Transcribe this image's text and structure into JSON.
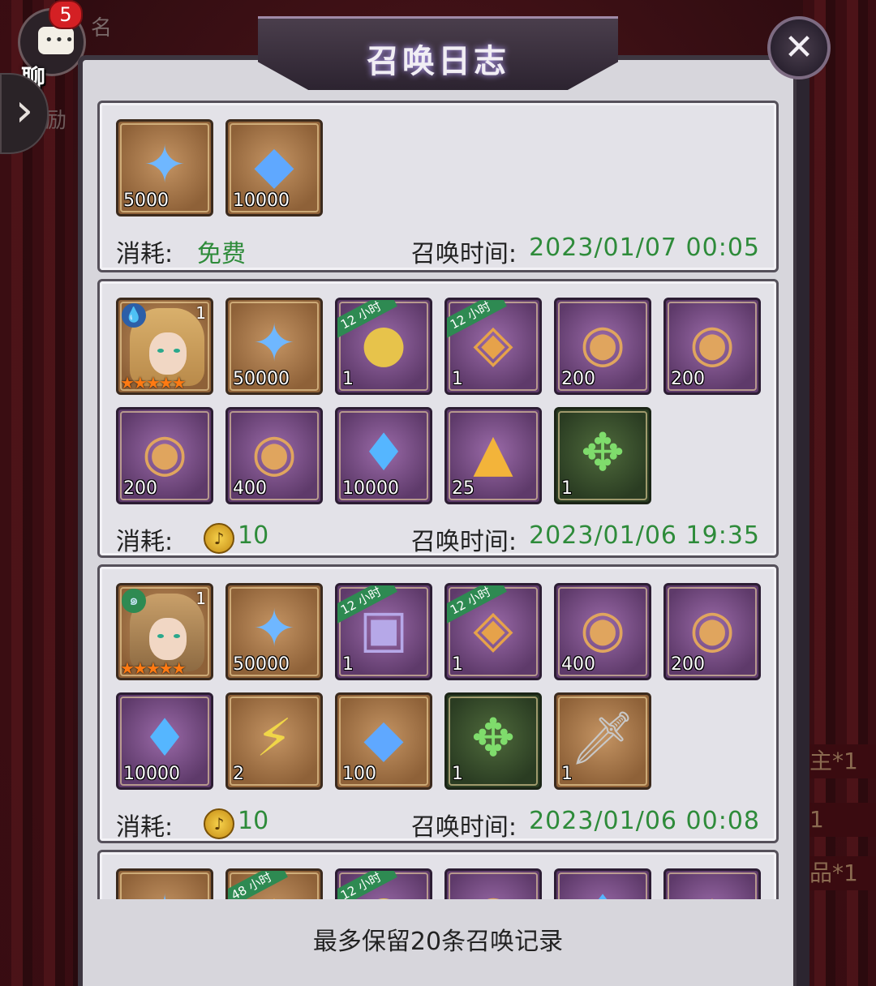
{
  "title": "召唤日志",
  "chat": {
    "badge": "5",
    "label": "聊 天"
  },
  "background": {
    "name_fragment": "名",
    "reward_fragment": "励"
  },
  "background_right": [
    "主*1",
    "1",
    "品*1"
  ],
  "records": [
    {
      "items": [
        {
          "kind": "exp",
          "count": "5000",
          "frame": "brown",
          "icon": "exp-icon"
        },
        {
          "kind": "diamond",
          "count": "10000",
          "frame": "brown",
          "icon": "diamond-icon"
        }
      ],
      "cost_label": "消耗:",
      "cost_text": "免费",
      "time_label": "召唤时间:",
      "time": "2023/01/07 00:05"
    },
    {
      "items": [
        {
          "kind": "hero",
          "count": "1",
          "frame": "brown",
          "icon": "hero-portrait-icon",
          "element": "water"
        },
        {
          "kind": "exp",
          "count": "50000",
          "frame": "brown",
          "icon": "exp-icon"
        },
        {
          "kind": "gold",
          "count": "1",
          "frame": "purple",
          "icon": "gold-coins-icon",
          "tag": "12 小时"
        },
        {
          "kind": "ore",
          "count": "1",
          "frame": "purple",
          "icon": "ore-icon",
          "tag": "12 小时"
        },
        {
          "kind": "orb",
          "count": "200",
          "frame": "purple",
          "icon": "orb-icon"
        },
        {
          "kind": "orb",
          "count": "200",
          "frame": "purple",
          "icon": "orb-icon"
        },
        {
          "kind": "orb",
          "count": "200",
          "frame": "purple",
          "icon": "orb-icon"
        },
        {
          "kind": "orb",
          "count": "400",
          "frame": "purple",
          "icon": "orb-icon"
        },
        {
          "kind": "crystal",
          "count": "10000",
          "frame": "purple",
          "icon": "crystal-icon"
        },
        {
          "kind": "rune",
          "count": "25",
          "frame": "purple",
          "icon": "rune-icon"
        },
        {
          "kind": "emblem",
          "count": "1",
          "frame": "green",
          "icon": "emblem-icon"
        }
      ],
      "cost_label": "消耗:",
      "cost_value": "10",
      "time_label": "召唤时间:",
      "time": "2023/01/06 19:35"
    },
    {
      "items": [
        {
          "kind": "hero",
          "count": "1",
          "frame": "brown",
          "icon": "hero-portrait-icon",
          "element": "wind"
        },
        {
          "kind": "exp",
          "count": "50000",
          "frame": "brown",
          "icon": "exp-icon"
        },
        {
          "kind": "gift",
          "count": "1",
          "frame": "purple",
          "icon": "exp-gift-box-icon",
          "tag": "12 小时"
        },
        {
          "kind": "ore",
          "count": "1",
          "frame": "purple",
          "icon": "ore-icon",
          "tag": "12 小时"
        },
        {
          "kind": "orb",
          "count": "400",
          "frame": "purple",
          "icon": "orb-icon"
        },
        {
          "kind": "orb",
          "count": "200",
          "frame": "purple",
          "icon": "orb-icon"
        },
        {
          "kind": "crystal",
          "count": "10000",
          "frame": "purple",
          "icon": "crystal-icon"
        },
        {
          "kind": "lightning",
          "count": "2",
          "frame": "brown",
          "icon": "lightning-icon"
        },
        {
          "kind": "diamond",
          "count": "100",
          "frame": "brown",
          "icon": "diamond-icon"
        },
        {
          "kind": "emblem",
          "count": "1",
          "frame": "green",
          "icon": "emblem-icon"
        },
        {
          "kind": "sword",
          "count": "1",
          "frame": "brown",
          "icon": "sword-icon"
        }
      ],
      "cost_label": "消耗:",
      "cost_value": "10",
      "time_label": "召唤时间:",
      "time": "2023/01/06 00:08"
    },
    {
      "items": [
        {
          "kind": "exp",
          "count": "",
          "frame": "brown",
          "icon": "exp-icon"
        },
        {
          "kind": "ore",
          "count": "",
          "frame": "brown",
          "icon": "ore-icon",
          "tag": "48 小时"
        },
        {
          "kind": "gold",
          "count": "",
          "frame": "purple",
          "icon": "gold-coins-icon",
          "tag": "12 小时"
        },
        {
          "kind": "orb",
          "count": "",
          "frame": "purple",
          "icon": "orb-icon"
        },
        {
          "kind": "crystal",
          "count": "",
          "frame": "purple",
          "icon": "crystal-icon"
        },
        {
          "kind": "rune",
          "count": "",
          "frame": "purple",
          "icon": "rune-icon"
        }
      ]
    }
  ],
  "bottom_note": "最多保留20条召唤记录",
  "colors": {
    "green_text": "#2e8b3a",
    "panel_bg": "#d7d6dc",
    "card_bg": "#e3e2e8"
  }
}
